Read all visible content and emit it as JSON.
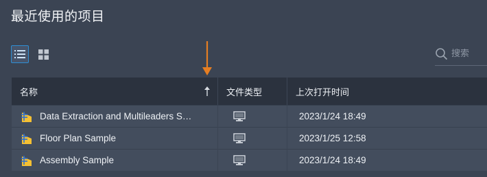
{
  "page": {
    "title": "最近使用的项目"
  },
  "toolbar": {
    "view_list_icon": "list-view-icon",
    "view_grid_icon": "grid-view-icon",
    "search_placeholder": "搜索"
  },
  "table": {
    "columns": [
      {
        "label": "名称",
        "sort": "ascending"
      },
      {
        "label": "文件类型"
      },
      {
        "label": "上次打开时间"
      }
    ],
    "rows": [
      {
        "name": "Data Extraction and Multileaders S…",
        "type_icon": "local-computer-icon",
        "last_opened": "2023/1/24 18:49"
      },
      {
        "name": "Floor Plan Sample",
        "type_icon": "local-computer-icon",
        "last_opened": "2023/1/25 12:58"
      },
      {
        "name": "Assembly Sample",
        "type_icon": "local-computer-icon",
        "last_opened": "2023/1/24 18:49"
      }
    ]
  },
  "colors": {
    "background": "#3b4453",
    "header_bg": "#2b323e",
    "row_bg": "#434d5d",
    "accent": "#2e8fd6",
    "annotation_arrow": "#e67e22",
    "file_icon_yellow": "#f5c033",
    "file_icon_blue": "#2f6fd1"
  }
}
